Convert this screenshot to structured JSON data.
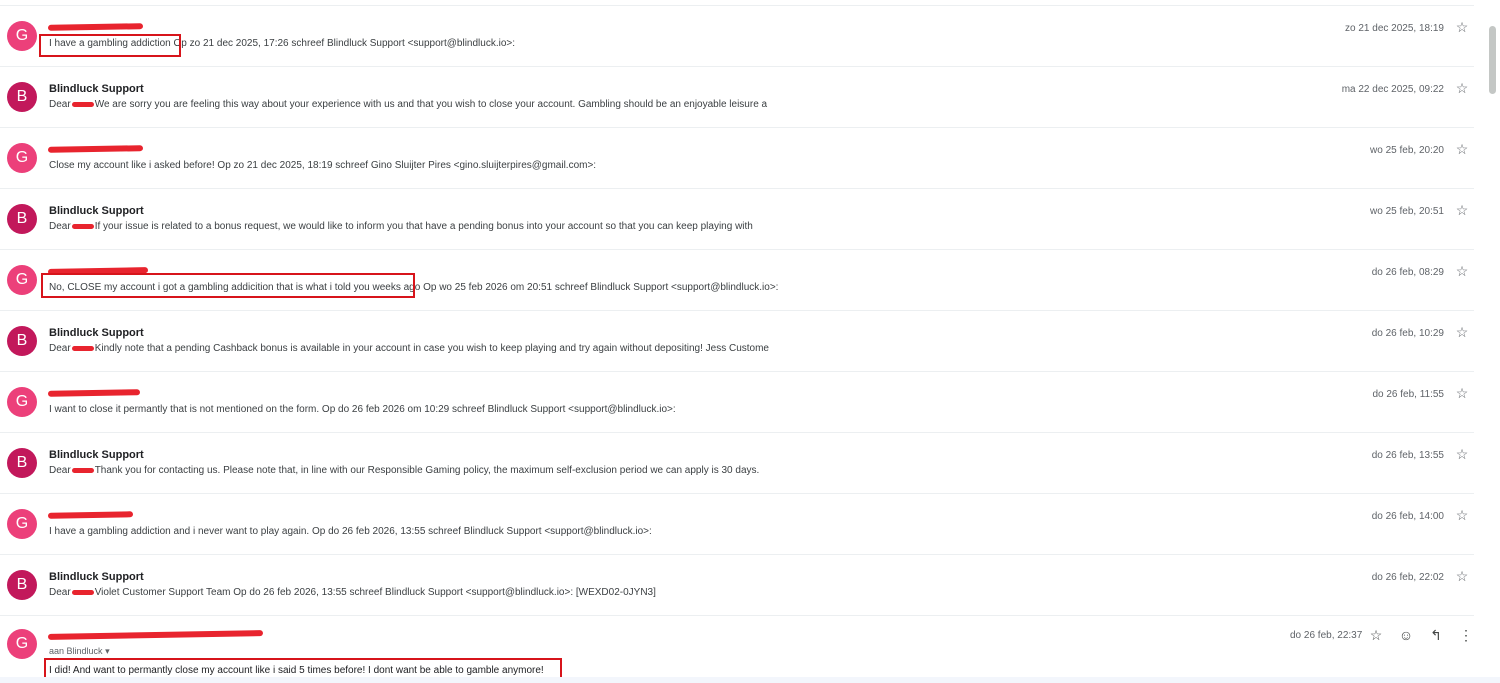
{
  "messages": [
    {
      "initial": "G",
      "sender": "",
      "snippet": "I have a gambling addiction Op zo 21 dec 2025, 17:26 schreef Blindluck Support <support@blindluck.io>:",
      "date": "zo 21 dec 2025, 18:19"
    },
    {
      "initial": "B",
      "sender": "Blindluck Support",
      "snippet_pre": "Dear",
      "snippet": "We are sorry you are feeling this way about your experience with us and that you wish to close your account. Gambling should be an enjoyable leisure a",
      "date": "ma 22 dec 2025, 09:22"
    },
    {
      "initial": "G",
      "sender": "",
      "snippet": "Close my account like i asked before! Op zo 21 dec 2025, 18:19 schreef Gino Sluijter Pires <gino.sluijterpires@gmail.com>:",
      "date": "wo 25 feb, 20:20"
    },
    {
      "initial": "B",
      "sender": "Blindluck Support",
      "snippet_pre": "Dear",
      "snippet": "If your issue is related to a bonus request, we would like to inform you that have a pending bonus into your account so that you can keep playing with",
      "date": "wo 25 feb, 20:51"
    },
    {
      "initial": "G",
      "sender": "",
      "snippet": "No, CLOSE my account i got a gambling addicition that is what i told you weeks ago Op wo 25 feb 2026 om 20:51 schreef Blindluck Support <support@blindluck.io>:",
      "date": "do 26 feb, 08:29"
    },
    {
      "initial": "B",
      "sender": "Blindluck Support",
      "snippet_pre": "Dear",
      "snippet": "Kindly note that a pending Cashback bonus is available in your account in case you wish to keep playing and try again without depositing! Jess Custome",
      "date": "do 26 feb, 10:29"
    },
    {
      "initial": "G",
      "sender": "",
      "snippet": "I want to close it permantly that is not mentioned on the form. Op do 26 feb 2026 om 10:29 schreef Blindluck Support <support@blindluck.io>:",
      "date": "do 26 feb, 11:55"
    },
    {
      "initial": "B",
      "sender": "Blindluck Support",
      "snippet_pre": "Dear",
      "snippet": "Thank you for contacting us. Please note that, in line with our Responsible Gaming policy, the maximum self-exclusion period we can apply is 30 days.",
      "date": "do 26 feb, 13:55"
    },
    {
      "initial": "G",
      "sender": "",
      "snippet": "I have a gambling addiction and i never want to play again. Op do 26 feb 2026, 13:55 schreef Blindluck Support <support@blindluck.io>:",
      "date": "do 26 feb, 14:00"
    },
    {
      "initial": "B",
      "sender": "Blindluck Support",
      "snippet_pre": "Dear",
      "snippet": "Violet Customer Support Team Op do 26 feb 2026, 13:55 schreef Blindluck Support <support@blindluck.io>: [WEXD02-0JYN3]",
      "date": "do 26 feb, 22:02"
    }
  ],
  "last_message": {
    "initial": "G",
    "to_line": "aan Blindluck",
    "to_caret": "▾",
    "body": "I did! And want to permantly close my account like i said 5 times before! I dont want be able to gamble anymore!",
    "date": "do 26 feb, 22:37"
  },
  "icons": {
    "star": "☆",
    "emoji": "☺",
    "reply": "↰",
    "more": "⋮"
  },
  "colors": {
    "avatar_g": "#ec407a",
    "avatar_b": "#c2185b",
    "highlight": "#d7141b",
    "redaction": "#e8242e"
  }
}
